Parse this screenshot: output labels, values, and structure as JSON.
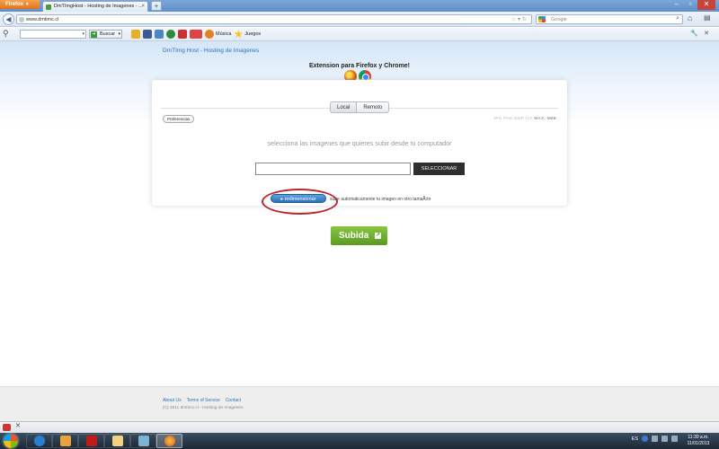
{
  "browser": {
    "menu_button": "Firefox",
    "tab_title": "DmTImgHost - Hosting de Imagenes - ...",
    "new_tab": "+",
    "url": "www.dmtimc.cl",
    "search_engine_placeholder": "Google"
  },
  "toolbar": {
    "search_label": "Buscar",
    "musica_label": "Música",
    "juegos_label": "Juegos"
  },
  "page": {
    "site_title": "DmTImg Host - Hosting de Imagenes",
    "extension_title": "Extension para Firefox y Chrome!",
    "tabs": [
      "Local",
      "Remoto"
    ],
    "preferences_label": "Preferencias",
    "formats_prefix": "JPG PNG BMP GIF",
    "formats_max": "MAX: 5MB",
    "select_text": "selecciona las imagenes que quieres subir desde tu computador",
    "select_button": "SELECCIONAR",
    "redim_button": "redimensionar",
    "redim_desc": "sube automaticamente tu imagen en otro tamaÃ±o",
    "upload_button": "Subida"
  },
  "footer": {
    "links": [
      "About Us",
      "Terms of Service",
      "Contact"
    ],
    "copyright": "(C) 2011 dmtimc.cl - Hosting de Imagenes"
  },
  "taskbar": {
    "language": "ES",
    "time": "11:30 a.m.",
    "date": "11/01/2013"
  },
  "colors": {
    "link": "#2f74b9",
    "upload_green": "#6aab2c",
    "highlight_red": "#c0242a",
    "redim_blue": "#2c72b8"
  }
}
